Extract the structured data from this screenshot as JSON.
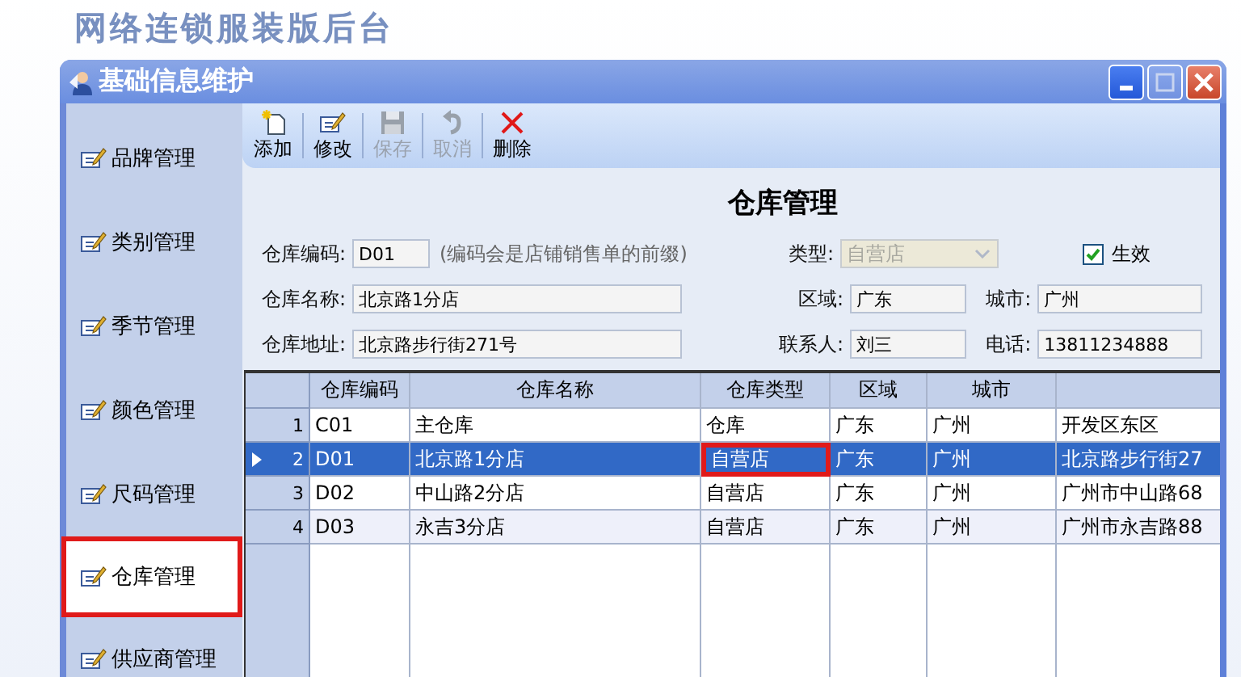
{
  "page_title": "网络连锁服装版后台",
  "window": {
    "title": "基础信息维护"
  },
  "sidebar": {
    "items": [
      {
        "label": "品牌管理",
        "selected": false
      },
      {
        "label": "类别管理",
        "selected": false
      },
      {
        "label": "季节管理",
        "selected": false
      },
      {
        "label": "颜色管理",
        "selected": false
      },
      {
        "label": "尺码管理",
        "selected": false
      },
      {
        "label": "仓库管理",
        "selected": true
      },
      {
        "label": "供应商管理",
        "selected": false
      }
    ]
  },
  "toolbar": [
    {
      "kind": "add",
      "label": "添加",
      "disabled": false
    },
    {
      "kind": "edit",
      "label": "修改",
      "disabled": false
    },
    {
      "kind": "save",
      "label": "保存",
      "disabled": true
    },
    {
      "kind": "undo",
      "label": "取消",
      "disabled": true
    },
    {
      "kind": "delete",
      "label": "删除",
      "disabled": false
    }
  ],
  "form": {
    "title": "仓库管理",
    "code": {
      "label": "仓库编码:",
      "value": "D01",
      "hint": "(编码会是店铺销售单的前缀)"
    },
    "type": {
      "label": "类型:",
      "value": "自营店",
      "disabled": true
    },
    "active": {
      "label": "生效",
      "checked": true
    },
    "name": {
      "label": "仓库名称:",
      "value": "北京路1分店"
    },
    "region": {
      "label": "区域:",
      "value": "广东"
    },
    "city": {
      "label": "城市:",
      "value": "广州"
    },
    "address": {
      "label": "仓库地址:",
      "value": "北京路步行街271号"
    },
    "contact": {
      "label": "联系人:",
      "value": "刘三"
    },
    "phone": {
      "label": "电话:",
      "value": "13811234888"
    }
  },
  "table": {
    "columns": [
      "仓库编码",
      "仓库名称",
      "仓库类型",
      "区域",
      "城市",
      ""
    ],
    "rows": [
      {
        "number": "1",
        "selected": false,
        "cells": [
          {
            "text": "C01",
            "marked": false
          },
          {
            "text": "主仓库",
            "marked": false
          },
          {
            "text": "仓库",
            "marked": false
          },
          {
            "text": "广东",
            "marked": false
          },
          {
            "text": "广州",
            "marked": false
          },
          {
            "text": "开发区东区",
            "marked": false
          }
        ]
      },
      {
        "number": "2",
        "selected": true,
        "cells": [
          {
            "text": "D01",
            "marked": false
          },
          {
            "text": "北京路1分店",
            "marked": false
          },
          {
            "text": "自营店",
            "marked": true
          },
          {
            "text": "广东",
            "marked": false
          },
          {
            "text": "广州",
            "marked": false
          },
          {
            "text": "北京路步行街27",
            "marked": false
          }
        ]
      },
      {
        "number": "3",
        "selected": false,
        "cells": [
          {
            "text": "D02",
            "marked": false
          },
          {
            "text": "中山路2分店",
            "marked": false
          },
          {
            "text": "自营店",
            "marked": false
          },
          {
            "text": "广东",
            "marked": false
          },
          {
            "text": "广州",
            "marked": false
          },
          {
            "text": "广州市中山路68",
            "marked": false
          }
        ]
      },
      {
        "number": "4",
        "selected": false,
        "cells": [
          {
            "text": "D03",
            "marked": false
          },
          {
            "text": "永吉3分店",
            "marked": false
          },
          {
            "text": "自营店",
            "marked": false
          },
          {
            "text": "广东",
            "marked": false
          },
          {
            "text": "广州",
            "marked": false
          },
          {
            "text": "广州市永吉路88",
            "marked": false
          }
        ]
      }
    ]
  }
}
